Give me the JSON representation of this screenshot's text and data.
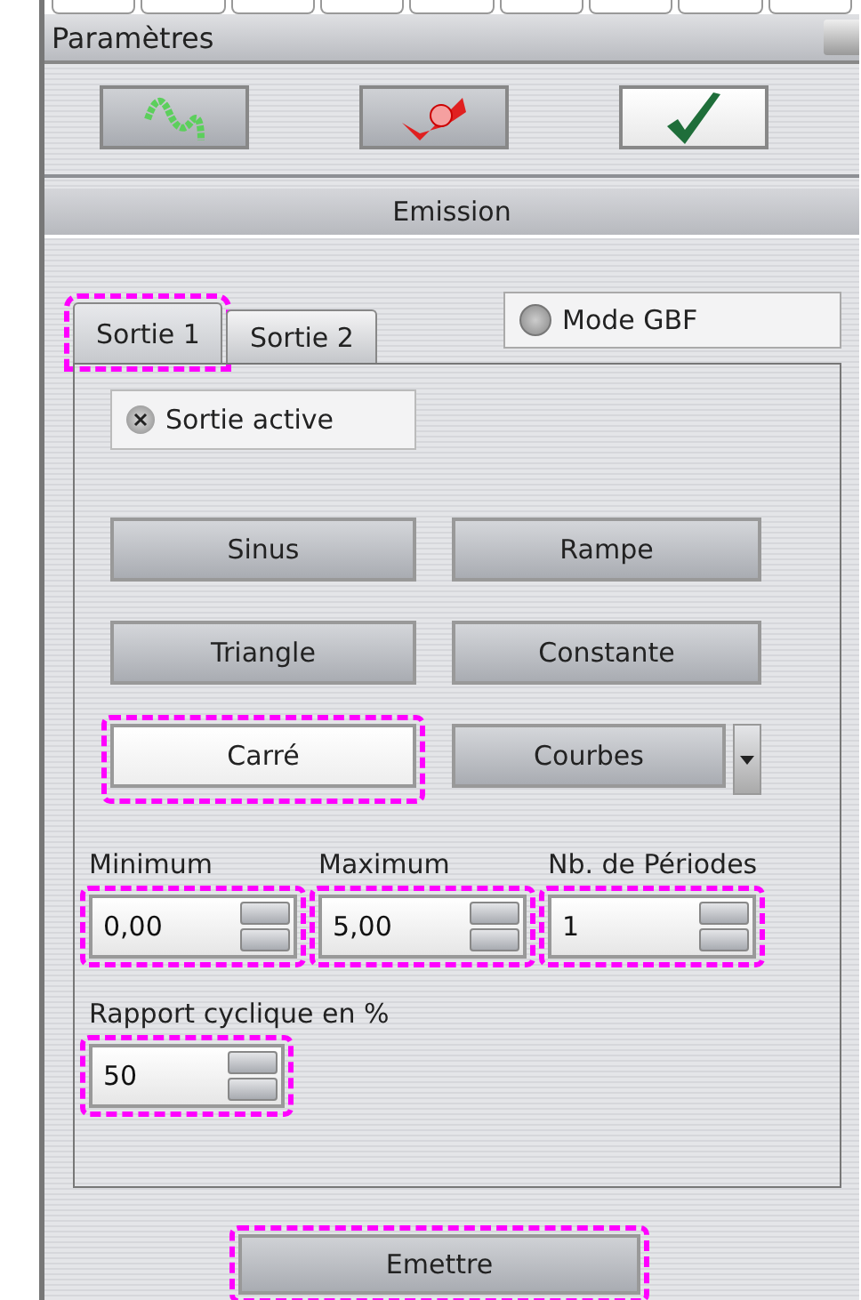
{
  "window": {
    "title": "Paramètres"
  },
  "toolbar": [
    {
      "kind": "wave",
      "selected": false
    },
    {
      "kind": "red",
      "selected": false
    },
    {
      "kind": "check",
      "selected": true
    }
  ],
  "section": {
    "title": "Emission"
  },
  "tabs": [
    {
      "label": "Sortie 1",
      "selected": true,
      "highlighted": true
    },
    {
      "label": "Sortie 2",
      "selected": false,
      "highlighted": false
    }
  ],
  "mode_gbf": {
    "label": "Mode GBF",
    "checked": false
  },
  "output_active": {
    "label": "Sortie active",
    "checked": true
  },
  "waveforms": [
    {
      "label": "Sinus",
      "selected": false,
      "highlighted": false
    },
    {
      "label": "Rampe",
      "selected": false,
      "highlighted": false
    },
    {
      "label": "Triangle",
      "selected": false,
      "highlighted": false
    },
    {
      "label": "Constante",
      "selected": false,
      "highlighted": false
    },
    {
      "label": "Carré",
      "selected": true,
      "highlighted": true
    },
    {
      "label": "Courbes",
      "selected": false,
      "highlighted": false,
      "dropdown": true
    }
  ],
  "fields": [
    {
      "label": "Minimum",
      "value": "0,00",
      "highlighted": true
    },
    {
      "label": "Maximum",
      "value": "5,00",
      "highlighted": true
    },
    {
      "label": "Nb. de Périodes",
      "value": "1",
      "highlighted": true
    }
  ],
  "duty": {
    "label": "Rapport cyclique en %",
    "value": "50",
    "highlighted": true
  },
  "emit_button": {
    "label": "Emettre",
    "highlighted": true
  }
}
